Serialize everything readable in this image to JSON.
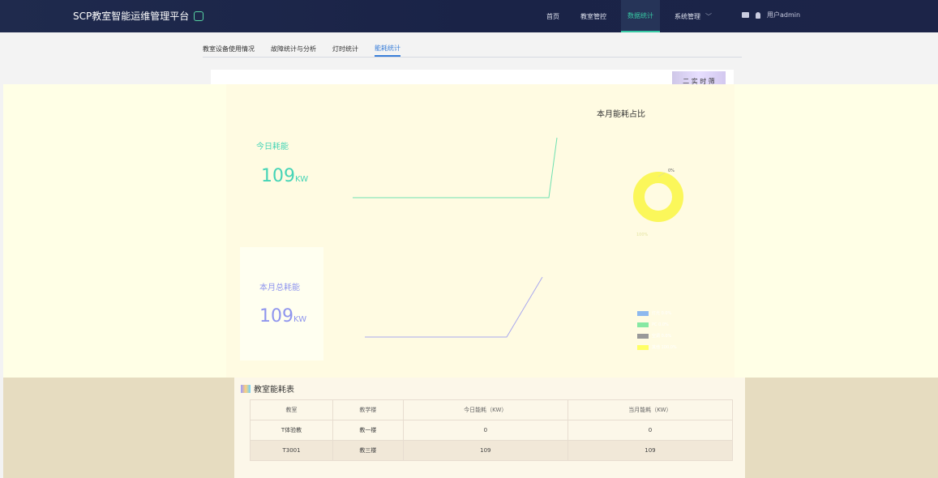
{
  "header": {
    "brand": "SCP教室智能运维管理平台",
    "nav": [
      {
        "label": "首页",
        "active": false
      },
      {
        "label": "教室管控",
        "active": false
      },
      {
        "label": "数据统计",
        "active": true
      },
      {
        "label": "系统管理",
        "active": false,
        "dropdown": true
      }
    ],
    "user": "用户admin"
  },
  "subnav": [
    {
      "label": "教室设备使用情况",
      "active": false
    },
    {
      "label": "故障统计与分析",
      "active": false
    },
    {
      "label": "灯时统计",
      "active": false
    },
    {
      "label": "能耗统计",
      "active": true
    }
  ],
  "filter_label": "二 实 时 筛",
  "today": {
    "title": "今日耗能",
    "value": "109",
    "unit": "KW"
  },
  "month": {
    "title": "本月总耗能",
    "value": "109",
    "unit": "KW"
  },
  "pie": {
    "title": "本月能耗占比",
    "label_top": "0%",
    "label_bottom": "100%"
  },
  "legend": [
    {
      "label": "灯光 0.0%",
      "color": "#8db8ee"
    },
    {
      "label": "PC 0.0%",
      "color": "#86e8a3"
    },
    {
      "label": "空调 0.0%",
      "color": "#999999"
    },
    {
      "label": "其他 100.0%",
      "color": "#ffff66"
    }
  ],
  "table": {
    "title": "教室能耗表",
    "columns": [
      "教室",
      "教学楼",
      "今日能耗（KW）",
      "当月能耗（KW）"
    ],
    "rows": [
      [
        "T体验教",
        "教一楼",
        "0",
        "0"
      ],
      [
        "T3001",
        "教三楼",
        "109",
        "109"
      ]
    ]
  },
  "colors": {
    "topbar": "#1f2a4d",
    "accent": "#37c9a4",
    "tab_accent": "#3a7fd9",
    "today": "#45d4b6",
    "month": "#8f95ee"
  }
}
